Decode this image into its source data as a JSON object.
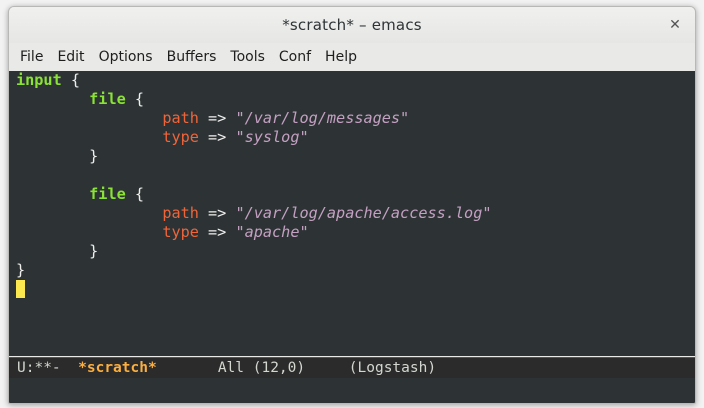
{
  "window": {
    "title": "*scratch* – emacs",
    "close_glyph": "✕"
  },
  "menubar": {
    "items": [
      "File",
      "Edit",
      "Options",
      "Buffers",
      "Tools",
      "Conf",
      "Help"
    ]
  },
  "buffer": {
    "lines": [
      {
        "indent": "",
        "tokens": [
          {
            "k": "kw",
            "t": "input"
          },
          {
            "k": "plain",
            "t": " {"
          }
        ]
      },
      {
        "indent": "        ",
        "tokens": [
          {
            "k": "kw",
            "t": "file"
          },
          {
            "k": "plain",
            "t": " {"
          }
        ]
      },
      {
        "indent": "                ",
        "tokens": [
          {
            "k": "attr",
            "t": "path"
          },
          {
            "k": "plain",
            "t": " => "
          },
          {
            "k": "str",
            "t": "\"/var/log/messages\""
          }
        ]
      },
      {
        "indent": "                ",
        "tokens": [
          {
            "k": "attr",
            "t": "type"
          },
          {
            "k": "plain",
            "t": " => "
          },
          {
            "k": "str",
            "t": "\"syslog\""
          }
        ]
      },
      {
        "indent": "        ",
        "tokens": [
          {
            "k": "plain",
            "t": "}"
          }
        ]
      },
      {
        "indent": "",
        "tokens": []
      },
      {
        "indent": "        ",
        "tokens": [
          {
            "k": "kw",
            "t": "file"
          },
          {
            "k": "plain",
            "t": " {"
          }
        ]
      },
      {
        "indent": "                ",
        "tokens": [
          {
            "k": "attr",
            "t": "path"
          },
          {
            "k": "plain",
            "t": " => "
          },
          {
            "k": "str",
            "t": "\"/var/log/apache/access.log\""
          }
        ]
      },
      {
        "indent": "                ",
        "tokens": [
          {
            "k": "attr",
            "t": "type"
          },
          {
            "k": "plain",
            "t": " => "
          },
          {
            "k": "str",
            "t": "\"apache\""
          }
        ]
      },
      {
        "indent": "        ",
        "tokens": [
          {
            "k": "plain",
            "t": "}"
          }
        ]
      },
      {
        "indent": "",
        "tokens": [
          {
            "k": "plain",
            "t": "}"
          }
        ]
      },
      {
        "indent": "",
        "tokens": [],
        "cursor": true
      }
    ]
  },
  "modeline": {
    "status": "U:**-",
    "buffer_name": "*scratch*",
    "position": "All (12,0)",
    "mode": "(Logstash)"
  },
  "colors": {
    "background": "#2d3335",
    "keyword": "#8ae234",
    "attribute": "#f0643a",
    "string": "#c4a0c2",
    "cursor": "#fce94f",
    "modeline_buffer": "#fcaf3e"
  }
}
